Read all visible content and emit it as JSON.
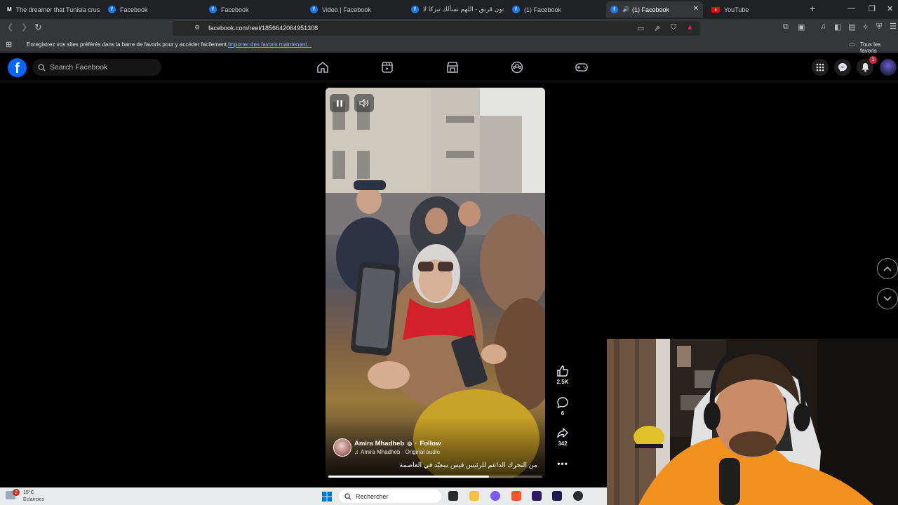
{
  "browser": {
    "tabs": [
      {
        "title": "The dreamer that Tunisia crush",
        "favicon": "medium"
      },
      {
        "title": "Facebook",
        "favicon": "facebook"
      },
      {
        "title": "Facebook",
        "favicon": "facebook"
      },
      {
        "title": "Video | Facebook",
        "favicon": "facebook"
      },
      {
        "title": "جون قرنق - اللهم نسألك تيزكا لا",
        "favicon": "facebook"
      },
      {
        "title": "(1) Facebook",
        "favicon": "facebook"
      },
      {
        "title": "(1) Facebook",
        "favicon": "facebook",
        "active": true
      },
      {
        "title": "YouTube",
        "favicon": "youtube"
      }
    ],
    "new_tab": "+",
    "url": "facebook.com/reel/1856642064951308",
    "bookmarks_prompt": "Enregistrez vos sites préférés dans la barre de favoris pour y accéder facilement.",
    "bookmarks_import": "Importer des favoris maintenant...",
    "all_bookmarks": "Tous les favoris"
  },
  "facebook": {
    "logo": "f",
    "search_placeholder": "Search Facebook",
    "notifications_count": "1"
  },
  "reel": {
    "author": "Amira Mhadheb",
    "follow": "Follow",
    "audio": "Amira Mhadheb · Original audio",
    "caption": "من التحرك الداعم للرئيس قيس سعيّد في العاصمة",
    "likes": "2.5K",
    "comments": "6",
    "shares": "342",
    "progress": 0.75
  },
  "taskbar": {
    "temperature": "15°C",
    "weather": "Éclaircies",
    "weather_badge": "2",
    "search": "Rechercher"
  },
  "colors": {
    "facebook_blue": "#0866ff",
    "link": "#8ab4f8",
    "notification": "#e41e3f"
  }
}
